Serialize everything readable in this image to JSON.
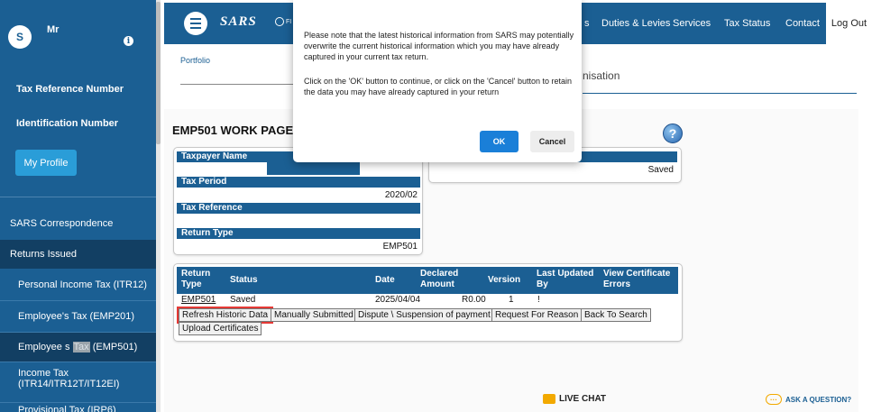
{
  "sidebar": {
    "avatar_initial": "S",
    "user_name": "Mr",
    "info_icon": "i",
    "tax_reference_label": "Tax Reference Number",
    "identification_label": "Identification Number",
    "profile_button": "My Profile",
    "menu": {
      "correspondence": "SARS Correspondence",
      "returns_issued": "Returns Issued",
      "itr12": "Personal Income Tax (ITR12)",
      "emp201": "Employee's Tax (EMP201)",
      "emp501_pre": "Employee s ",
      "emp501_mid": "Tax",
      "emp501_post": " (EMP501)",
      "income_tax_line1": "Income Tax",
      "income_tax_line2": "(ITR14/ITR12T/IT12EI)",
      "provisional": "Provisional Tax (IRP6)"
    }
  },
  "topnav": {
    "logo": "SARS",
    "logo_fragment": "FI",
    "links": {
      "s_fragment": "s",
      "duties": "Duties & Levies",
      "services": "Services",
      "tax_status": "Tax Status",
      "contact": "Contact",
      "logout": "Log Out"
    }
  },
  "content": {
    "breadcrumb": "Portfolio",
    "organisation_fragment": "nisation",
    "page_title": "EMP501 WORK PAGE",
    "help_icon": "?",
    "taxpayer_name_label": "Taxpayer Name",
    "tax_period_label": "Tax Period",
    "tax_period_value": "2020/02",
    "tax_reference_label": "Tax Reference",
    "return_type_label": "Return Type",
    "return_type_value": "EMP501",
    "status_value": "Saved"
  },
  "returns_table": {
    "headers": {
      "return_type_1": "Return",
      "return_type_2": "Type",
      "status": "Status",
      "date": "Date",
      "declared_1": "Declared",
      "declared_2": "Amount",
      "version": "Version",
      "updated_1": "Last Updated",
      "updated_2": "By",
      "certificate_1": "View Certificate",
      "certificate_2": "Errors"
    },
    "row": {
      "return_type": "EMP501",
      "status": "Saved",
      "date": "2025/04/04",
      "amount": "R0.00",
      "version": "1",
      "updated_by": "!"
    },
    "actions": {
      "refresh": "Refresh Historic Data",
      "manual": "Manually Submitted",
      "dispute": "Dispute \\ Suspension of payment",
      "reason": "Request For Reason",
      "back": "Back To Search",
      "upload": "Upload Certificates"
    }
  },
  "footer": {
    "live_chat": "LIVE CHAT",
    "ask": "ASK A QUESTION?"
  },
  "modal": {
    "message": "Please note that the latest historical information from SARS may potentially overwrite the current historical information which you may have already captured in your current tax return.",
    "instruction": "Click on the 'OK' button to continue, or click on the 'Cancel' button to retain the data you may have already captured in your return",
    "ok": "OK",
    "cancel": "Cancel"
  },
  "colors": {
    "brand_blue": "#1b5f93",
    "accent_blue": "#2a9dd8",
    "highlight_red": "#e53935",
    "chat_orange": "#f2a900"
  }
}
